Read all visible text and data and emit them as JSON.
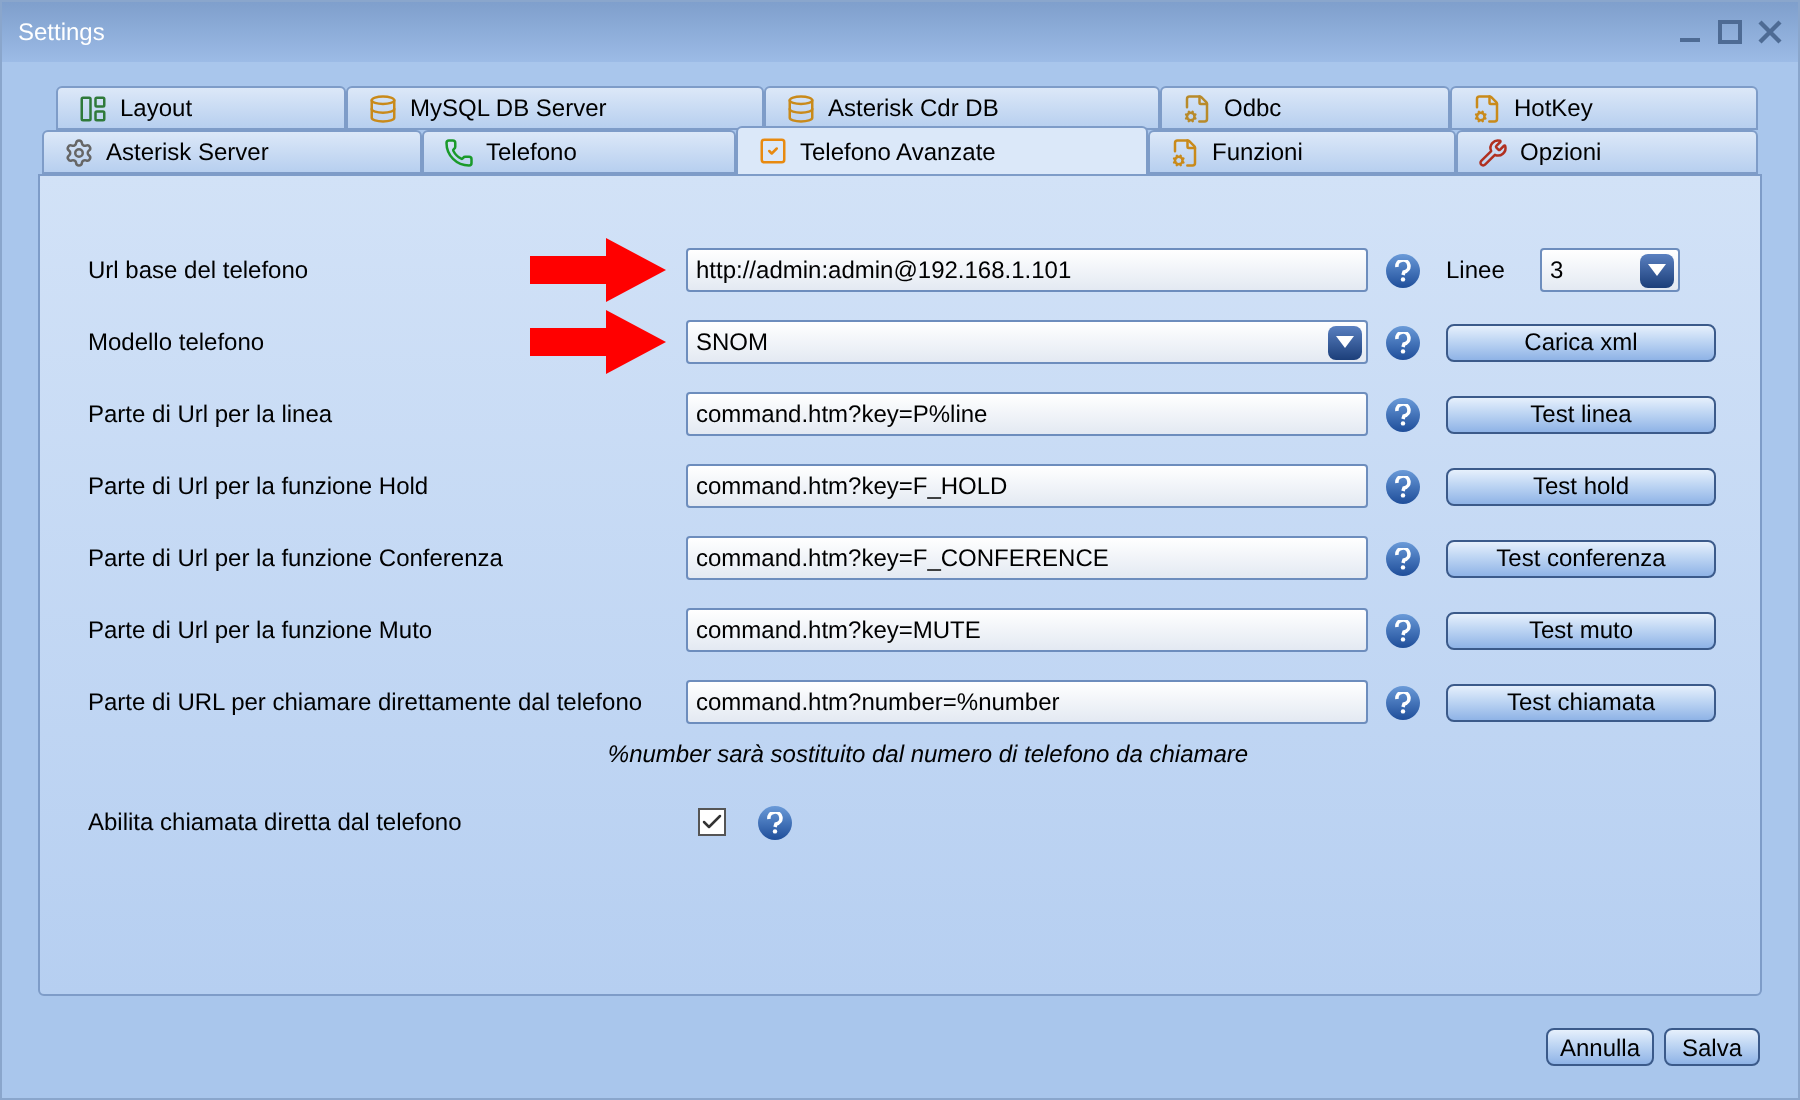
{
  "window": {
    "title": "Settings"
  },
  "tabs": [
    [
      {
        "label": "Layout",
        "selected": false
      },
      {
        "label": "MySQL DB Server",
        "selected": false
      },
      {
        "label": "Asterisk Cdr DB",
        "selected": false
      },
      {
        "label": "Odbc",
        "selected": false
      },
      {
        "label": "HotKey",
        "selected": false
      }
    ],
    [
      {
        "label": "Asterisk Server",
        "selected": false
      },
      {
        "label": "Telefono",
        "selected": false
      },
      {
        "label": "Telefono Avanzate",
        "selected": true
      },
      {
        "label": "Funzioni",
        "selected": false
      },
      {
        "label": "Opzioni",
        "selected": false
      }
    ]
  ],
  "rows": [
    {
      "label": "Url base del telefono",
      "field": {
        "kind": "text",
        "value": "http://admin:admin@192.168.1.101"
      },
      "arrow": true,
      "side": {
        "kind": "select",
        "label": "Linee",
        "value": "3"
      }
    },
    {
      "label": "Modello telefono",
      "field": {
        "kind": "select",
        "value": "SNOM"
      },
      "arrow": true,
      "side": {
        "kind": "button",
        "label": "Carica xml"
      }
    },
    {
      "label": "Parte di Url per la linea",
      "field": {
        "kind": "text",
        "value": "command.htm?key=P%line"
      },
      "arrow": false,
      "side": {
        "kind": "button",
        "label": "Test linea"
      }
    },
    {
      "label": "Parte di Url per la funzione Hold",
      "field": {
        "kind": "text",
        "value": "command.htm?key=F_HOLD"
      },
      "arrow": false,
      "side": {
        "kind": "button",
        "label": "Test hold"
      }
    },
    {
      "label": "Parte di Url per la funzione Conferenza",
      "field": {
        "kind": "text",
        "value": "command.htm?key=F_CONFERENCE"
      },
      "arrow": false,
      "side": {
        "kind": "button",
        "label": "Test conferenza"
      }
    },
    {
      "label": "Parte di Url per la funzione Muto",
      "field": {
        "kind": "text",
        "value": "command.htm?key=MUTE"
      },
      "arrow": false,
      "side": {
        "kind": "button",
        "label": "Test muto"
      }
    },
    {
      "label": "Parte di URL per chiamare direttamente dal telefono",
      "field": {
        "kind": "text",
        "value": "command.htm?number=%number"
      },
      "arrow": false,
      "side": {
        "kind": "button",
        "label": "Test chiamata"
      }
    }
  ],
  "note": "%number sarà sostituito dal numero di telefono da chiamare",
  "direct_call": {
    "label": "Abilita chiamata diretta dal telefono",
    "checked": true
  },
  "buttons": [
    "Annulla",
    "Salva"
  ]
}
